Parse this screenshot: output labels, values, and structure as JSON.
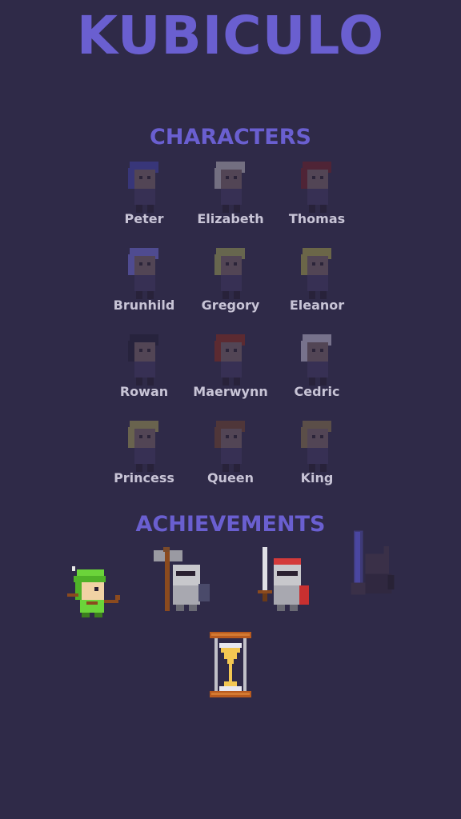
{
  "app": {
    "title": "KUBICULO"
  },
  "characters": {
    "heading": "CHARACTERS",
    "items": [
      {
        "name": "Peter",
        "icon": "peter-sprite-icon",
        "hair": "#3c3a8a"
      },
      {
        "name": "Elizabeth",
        "icon": "elizabeth-sprite-icon",
        "hair": "#8a8694"
      },
      {
        "name": "Thomas",
        "icon": "thomas-sprite-icon",
        "hair": "#5a2230"
      },
      {
        "name": "Brunhild",
        "icon": "brunhild-sprite-icon",
        "hair": "#5a56a8"
      },
      {
        "name": "Gregory",
        "icon": "gregory-sprite-icon",
        "hair": "#7a7a50"
      },
      {
        "name": "Eleanor",
        "icon": "eleanor-sprite-icon",
        "hair": "#7f7a48"
      },
      {
        "name": "Rowan",
        "icon": "rowan-sprite-icon",
        "hair": "#25213a"
      },
      {
        "name": "Maerwynn",
        "icon": "maerwynn-sprite-icon",
        "hair": "#6b2a2a"
      },
      {
        "name": "Cedric",
        "icon": "cedric-sprite-icon",
        "hair": "#8f8aa3"
      },
      {
        "name": "Princess",
        "icon": "princess-sprite-icon",
        "hair": "#7d7650"
      },
      {
        "name": "Queen",
        "icon": "queen-sprite-icon",
        "hair": "#5a3a34"
      },
      {
        "name": "King",
        "icon": "king-sprite-icon",
        "hair": "#6a5a48"
      }
    ]
  },
  "achievements": {
    "heading": "ACHIEVEMENTS",
    "items": [
      {
        "icon": "archer-achievement-icon",
        "unlocked": true
      },
      {
        "icon": "axe-knight-achievement-icon",
        "unlocked": true
      },
      {
        "icon": "sword-knight-achievement-icon",
        "unlocked": true
      },
      {
        "icon": "dark-knight-achievement-icon",
        "unlocked": false
      }
    ]
  },
  "loading": {
    "icon": "hourglass-icon"
  },
  "colors": {
    "background": "#2f2a48",
    "accent": "#6a5fd0",
    "label": "#c8c4d6",
    "sand": "#f3c752",
    "wood": "#a0521e"
  }
}
